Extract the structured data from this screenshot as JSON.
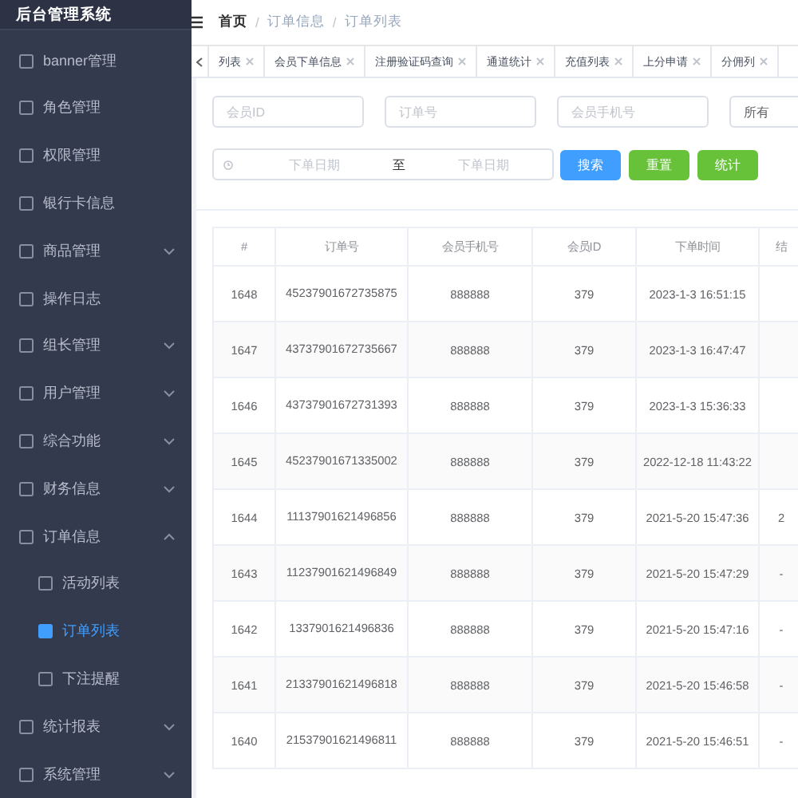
{
  "sidebar": {
    "title": "后台管理系统",
    "items": [
      {
        "label": "banner管理",
        "selected": false
      },
      {
        "label": "角色管理",
        "selected": false
      },
      {
        "label": "权限管理",
        "selected": false
      },
      {
        "label": "银行卡信息",
        "selected": false
      },
      {
        "label": "商品管理",
        "selected": false,
        "expanded": false
      },
      {
        "label": "操作日志",
        "selected": false
      },
      {
        "label": "组长管理",
        "selected": false,
        "expanded": false
      },
      {
        "label": "用户管理",
        "selected": false,
        "expanded": false
      },
      {
        "label": "综合功能",
        "selected": false,
        "expanded": false
      },
      {
        "label": "财务信息",
        "selected": false,
        "expanded": false
      },
      {
        "label": "订单信息",
        "selected": false,
        "expanded": true,
        "children": [
          {
            "label": "活动列表",
            "selected": false
          },
          {
            "label": "订单列表",
            "selected": true
          },
          {
            "label": "下注提醒",
            "selected": false
          }
        ]
      },
      {
        "label": "统计报表",
        "selected": false,
        "expanded": false
      },
      {
        "label": "系统管理",
        "selected": false,
        "expanded": false
      }
    ]
  },
  "breadcrumb": [
    "首页",
    "订单信息",
    "订单列表"
  ],
  "breadcrumb_separator": "/",
  "tabs": [
    {
      "label": "列表",
      "selected": false
    },
    {
      "label": "会员下单信息",
      "selected": false
    },
    {
      "label": "注册验证码查询",
      "selected": false
    },
    {
      "label": "通道统计",
      "selected": false
    },
    {
      "label": "充值列表",
      "selected": false
    },
    {
      "label": "上分申请",
      "selected": false
    },
    {
      "label": "分佣列",
      "selected": false
    }
  ],
  "filters": {
    "fields": [
      {
        "placeholder": "会员ID"
      },
      {
        "placeholder": "订单号"
      },
      {
        "placeholder": "会员手机号"
      }
    ],
    "select": {
      "value": "所有"
    },
    "date_start": {
      "placeholder": "下单日期"
    },
    "date_separator": "至",
    "date_end": {
      "placeholder": "下单日期"
    },
    "buttons": [
      {
        "label": "搜索",
        "kind": "primary"
      },
      {
        "label": "重置",
        "kind": "success"
      },
      {
        "label": "统计",
        "kind": "success"
      }
    ]
  },
  "table": {
    "columns": [
      "#",
      "订单号",
      "会员手机号",
      "会员ID",
      "下单时间",
      "结"
    ],
    "rows": [
      [
        "1648",
        "45237901672735875",
        "888888",
        "379",
        "2023-1-3 16:51:15",
        ""
      ],
      [
        "1647",
        "43737901672735667",
        "888888",
        "379",
        "2023-1-3 16:47:47",
        ""
      ],
      [
        "1646",
        "43737901672731393",
        "888888",
        "379",
        "2023-1-3 15:36:33",
        ""
      ],
      [
        "1645",
        "45237901671335002",
        "888888",
        "379",
        "2022-12-18 11:43:22",
        ""
      ],
      [
        "1644",
        "11137901621496856",
        "888888",
        "379",
        "2021-5-20 15:47:36",
        "2"
      ],
      [
        "1643",
        "11237901621496849",
        "888888",
        "379",
        "2021-5-20 15:47:29",
        "-"
      ],
      [
        "1642",
        "1337901621496836",
        "888888",
        "379",
        "2021-5-20 15:47:16",
        "-"
      ],
      [
        "1641",
        "21337901621496818",
        "888888",
        "379",
        "2021-5-20 15:46:58",
        "-"
      ],
      [
        "1640",
        "21537901621496811",
        "888888",
        "379",
        "2021-5-20 15:46:51",
        "-"
      ]
    ]
  }
}
